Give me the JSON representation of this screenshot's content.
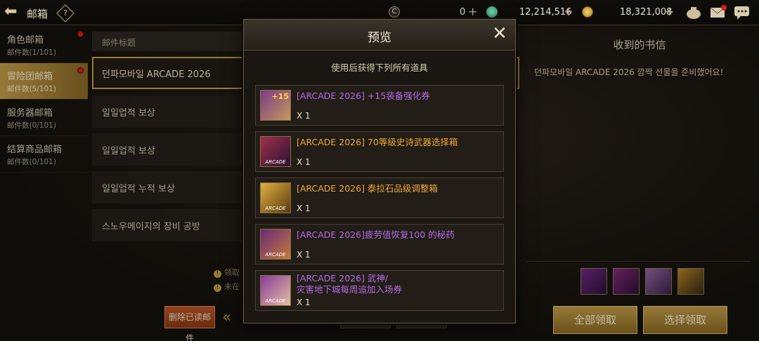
{
  "topbar": {
    "title": "邮箱",
    "help": "?",
    "currency1": "0",
    "currency2": "12,214,516",
    "currency3": "18,321,008",
    "colors": {
      "accent": "#c9a64e",
      "badge": "#d81e1e"
    }
  },
  "tabs": [
    {
      "label": "角色邮箱",
      "count": "邮件数(1/101)",
      "badge": true
    },
    {
      "label": "冒险团邮箱",
      "count": "邮件数(5/101)",
      "badge": true,
      "active": true
    },
    {
      "label": "服务器邮箱",
      "count": "邮件数(0/101)",
      "badge": false
    },
    {
      "label": "结算商品邮箱",
      "count": "邮件数(0/101)",
      "badge": false
    }
  ],
  "list": {
    "header": "邮件标题",
    "items": [
      "던파모바일 ARCADE 2026",
      "일일업적 보상",
      "일일업적 보상",
      "일일업적 누적 보상",
      "스노우메이지의 장비 공방"
    ],
    "notes": [
      "领取",
      "未在"
    ],
    "delete_label": "删除已读邮件",
    "pager_prev": "«"
  },
  "detail": {
    "title": "收到的书信",
    "body": "던파모바일 ARCADE 2026 깜짝 선물을 준비했어요!",
    "claim_all": "全部领取",
    "claim_select": "选择领取",
    "thumb_icons": [
      "arcade-box-icon",
      "arcade-box-icon",
      "arcade-ticket-icon",
      "arcade-gold-icon"
    ]
  },
  "modal": {
    "title": "预览",
    "subtitle": "使用后获得下列所有道具",
    "items": [
      {
        "name": "[ARCADE 2026] +15装备强化券",
        "qty": "X 1",
        "rarity": "purple",
        "icon": "enhance-ticket-icon",
        "badge": "+15"
      },
      {
        "name": "[ARCADE 2026] 70等级史诗武器选择箱",
        "qty": "X 1",
        "rarity": "orange",
        "icon": "weapon-box-icon",
        "badge": "ARCADE"
      },
      {
        "name": "[ARCADE 2026] 泰拉石品级调整箱",
        "qty": "X 1",
        "rarity": "orange",
        "icon": "tera-stone-box-icon",
        "badge": "ARCADE"
      },
      {
        "name": "[ARCADE 2026]疲劳值恢复100 的秘药",
        "qty": "X 1",
        "rarity": "purple",
        "icon": "potion-icon",
        "badge": "ARCADE"
      },
      {
        "name": "[ARCADE 2026] 武神/\n灾害地下城每周追加入场券",
        "qty": "X 1",
        "rarity": "purple",
        "icon": "dungeon-ticket-icon",
        "badge": "ARCADE"
      }
    ]
  }
}
